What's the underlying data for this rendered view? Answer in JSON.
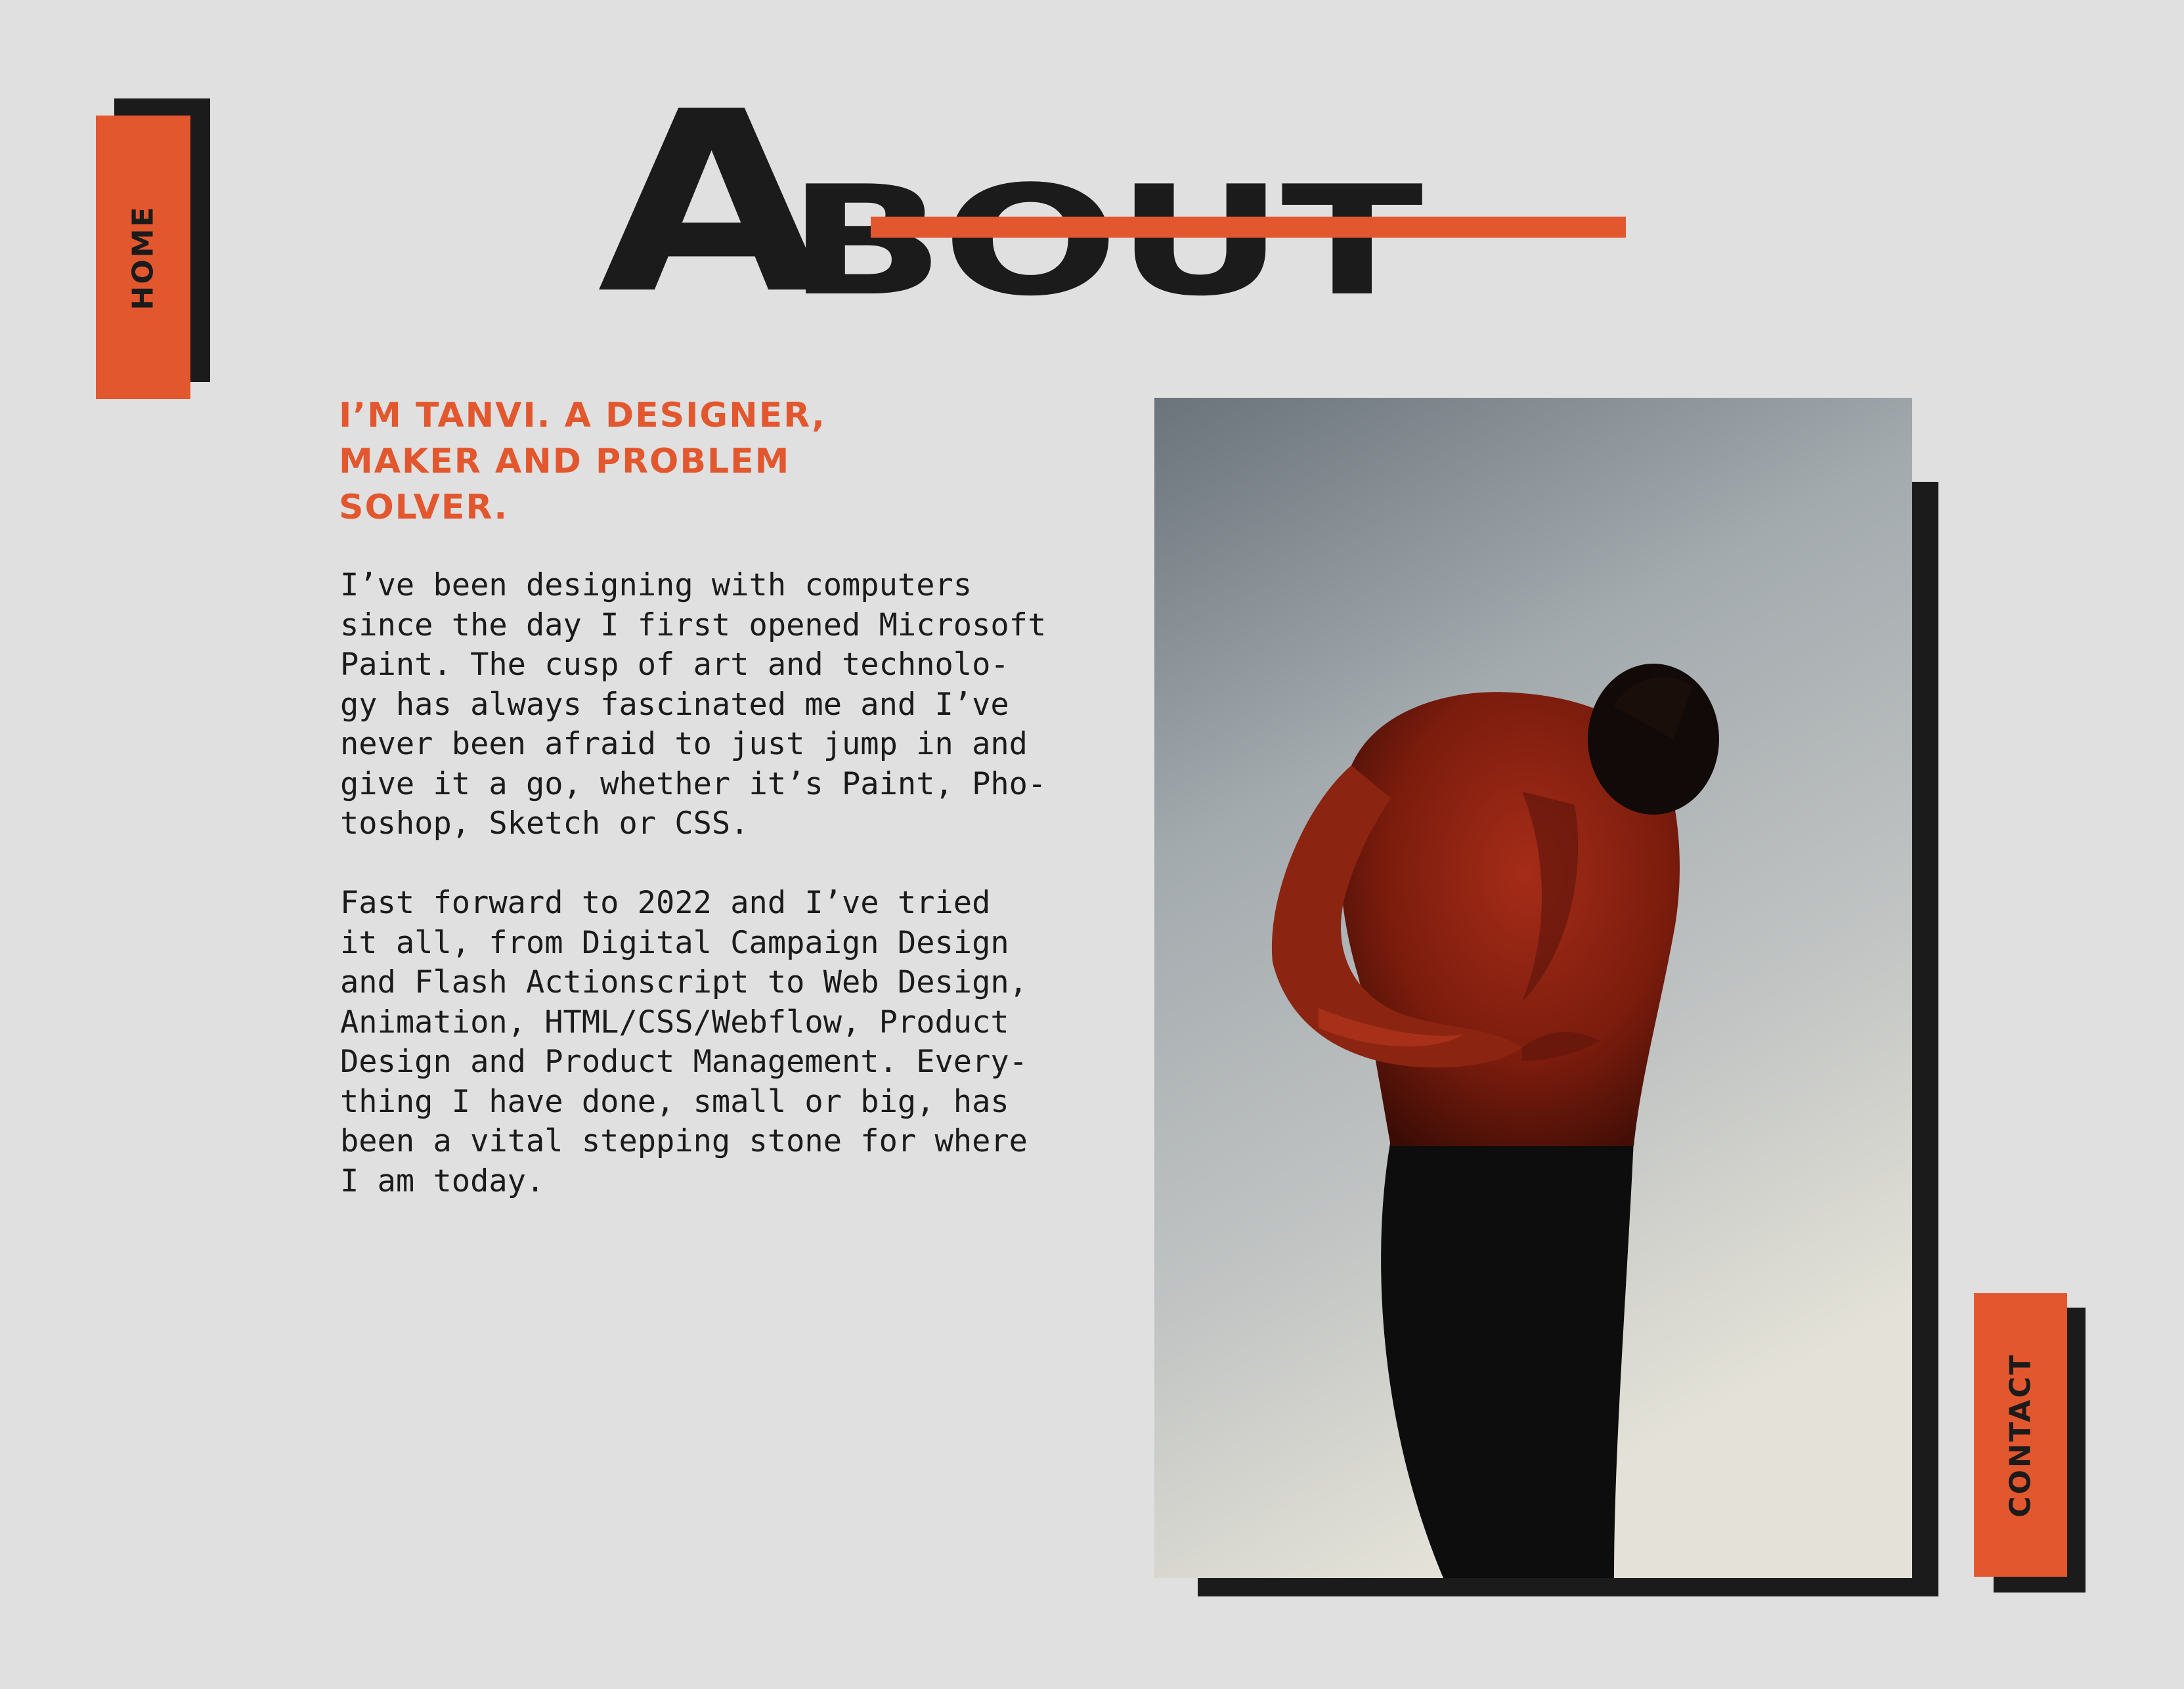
{
  "nav": {
    "home_label": "HOME",
    "contact_label": "CONTACT"
  },
  "title": {
    "first_letter": "A",
    "rest": "BOUT"
  },
  "intro": {
    "headline": "I’M TANVI. A DESIGNER,\nMAKER AND PROBLEM\nSOLVER.",
    "paragraphs": [
      "I’ve been designing with computers\nsince the day I first opened Microsoft\nPaint. The cusp of art and technolo-\ngy has always fascinated me and I’ve\nnever been afraid to just jump in and\ngive it a go, whether it’s Paint, Pho-\ntoshop, Sketch or CSS.",
      "Fast forward to 2022 and I’ve tried\nit all, from Digital Campaign Design\nand Flash Actionscript to Web Design,\nAnimation, HTML/CSS/Webflow, Product\nDesign and Product Management. Every-\nthing I have done, small or big, has\nbeen a vital stepping stone for where\nI am today."
    ]
  },
  "colors": {
    "background": "#e0e0e0",
    "accent": "#e2572e",
    "ink": "#1b1b1b"
  },
  "photo": {
    "icon": "portrait-photo"
  }
}
